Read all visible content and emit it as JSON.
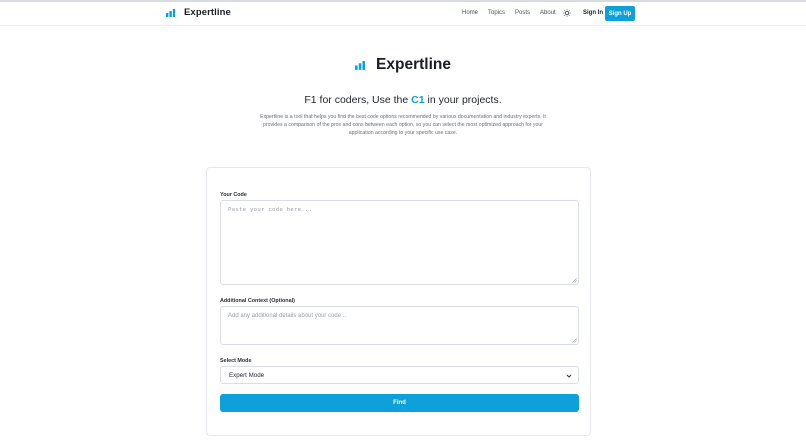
{
  "colors": {
    "accent": "#0ea1d9",
    "text": "#1b1e24",
    "muted": "#6b7079"
  },
  "nav": {
    "brand": "Expertline",
    "links": [
      "Home",
      "Topics",
      "Posts",
      "About"
    ],
    "theme_icon": "sun-icon",
    "signin": "Sign In",
    "signup": "Sign Up"
  },
  "hero": {
    "title": "Expertline",
    "tagline_pre": "F1 for coders, Use the ",
    "tagline_accent": "C1",
    "tagline_post": " in your projects.",
    "description": "Expertline is a tool that helps you find the best code options recommended by various documentation and industry experts. It provides a comparison of the pros and cons between each option, so you can select the most optimized approach for your application according to your specific use case."
  },
  "form": {
    "code_label": "Your Code",
    "code_placeholder": "Paste your code here...",
    "context_label": "Additional Context (Optional)",
    "context_placeholder": "Add any additional details about your code...",
    "mode_label": "Select Mode",
    "mode_value": "Expert Mode",
    "submit": "Find"
  }
}
